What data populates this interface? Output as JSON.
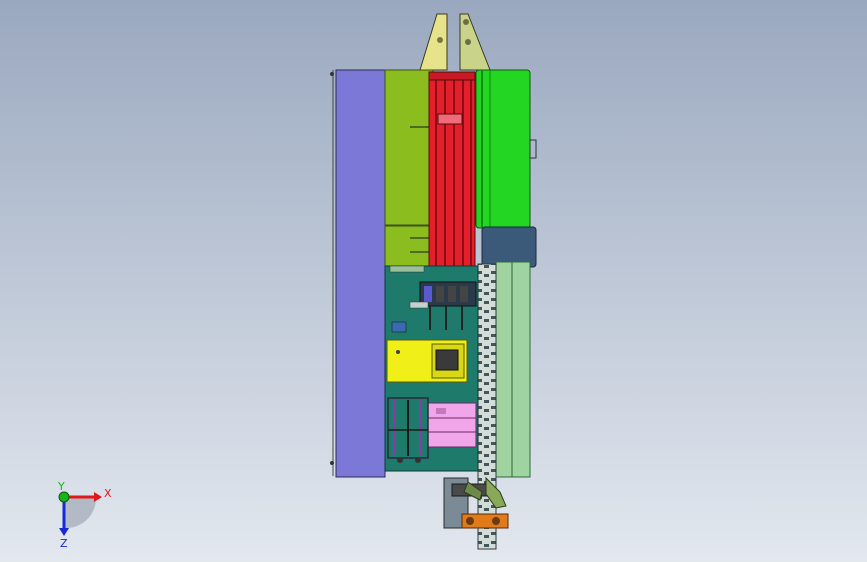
{
  "viewport": {
    "background_top": "#9aa8bf",
    "background_bottom": "#e3e8ef"
  },
  "model": {
    "colors": {
      "side_plate": "#7b78d8",
      "frame_green": "#8cbd1e",
      "motor_green": "#22d622",
      "rail_red": "#e41e2a",
      "rail_dark_red": "#8a0f14",
      "panel_teal": "#1e7a6a",
      "yellow_block": "#f0f018",
      "pink_block": "#f2a6ea",
      "slate_block": "#3b5a7a",
      "rail_lightgreen": "#9fd3a0",
      "chain_grey": "#6b7f86",
      "bracket_yellow": "#e6e38a",
      "orange_part": "#e07a1a"
    }
  },
  "triad": {
    "x_label": "X",
    "y_label": "Y",
    "z_label": "Z",
    "x_color": "#e01818",
    "y_color": "#18b418",
    "z_color": "#1828d8"
  }
}
